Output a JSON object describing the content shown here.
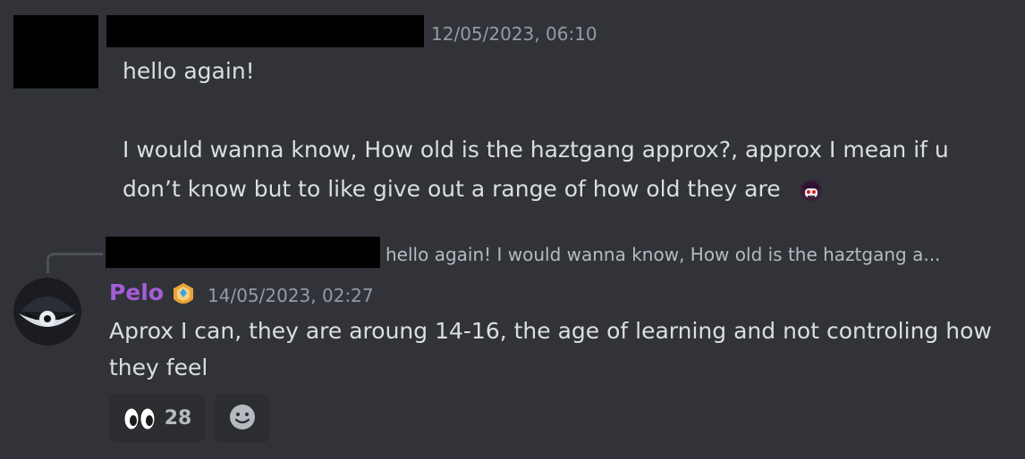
{
  "message1": {
    "timestamp": "12/05/2023, 06:10",
    "lines": [
      "hello again!",
      "",
      "I would wanna know, How old is the haztgang approx?, approx I mean if u",
      "don’t know but to like give out a range of how old they are"
    ],
    "emoji_icon": "custom-emoji-icon"
  },
  "reply": {
    "preview": "hello again!  I would wanna know, How old is the haztgang a..."
  },
  "message2": {
    "username": "Pelo",
    "badge_icon": "server-badge-icon",
    "timestamp": "14/05/2023, 02:27",
    "lines": [
      "Aprox I can, they are aroung 14-16, the age of learning and not controling how",
      "they feel"
    ],
    "reactions": [
      {
        "icon": "eyes-emoji-icon",
        "count": "28"
      }
    ],
    "add_reaction_icon": "add-reaction-icon"
  },
  "colors": {
    "background": "#313338",
    "username": "#a45dd7",
    "timestamp": "#949ba4"
  }
}
